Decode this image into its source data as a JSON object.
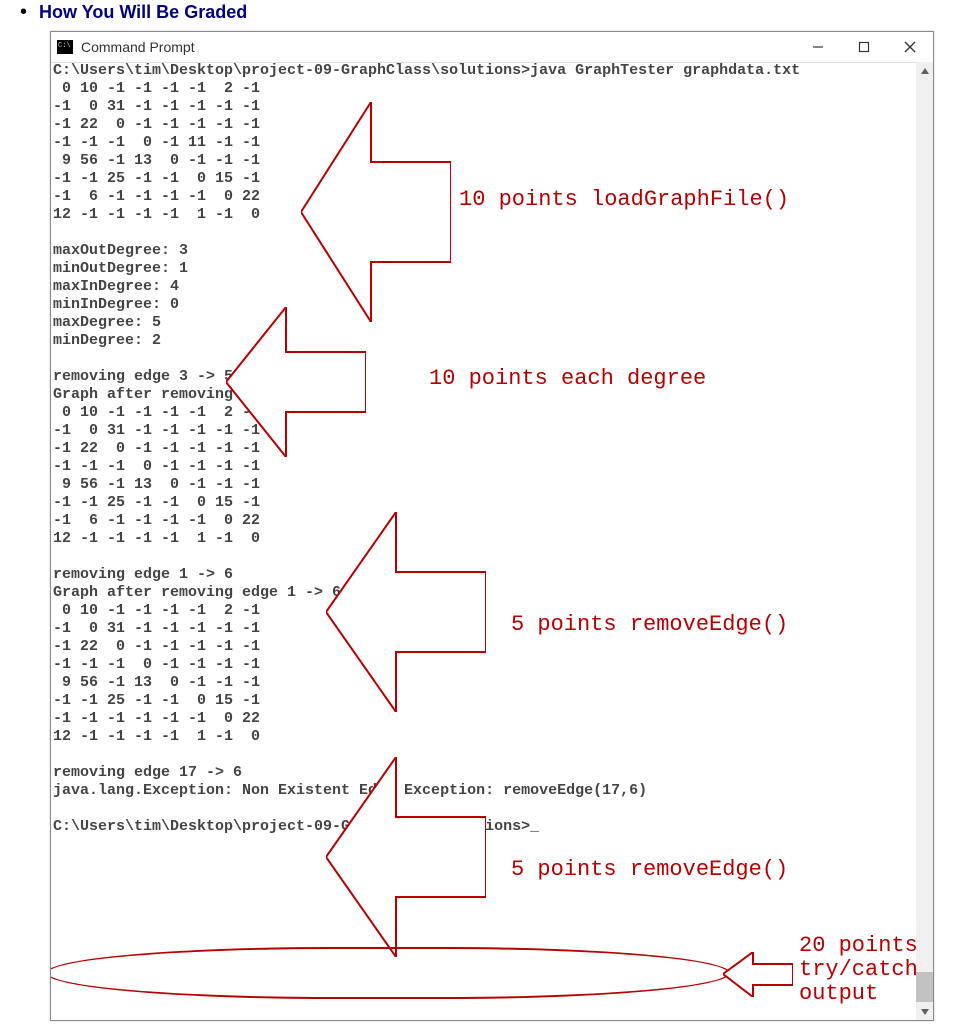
{
  "header": {
    "title": "How You Will Be Graded"
  },
  "window": {
    "title": "Command Prompt"
  },
  "console": {
    "line_cmd1": "C:\\Users\\tim\\Desktop\\project-09-GraphClass\\solutions>java GraphTester graphdata.txt",
    "matrix1": [
      " 0 10 -1 -1 -1 -1  2 -1",
      "-1  0 31 -1 -1 -1 -1 -1",
      "-1 22  0 -1 -1 -1 -1 -1",
      "-1 -1 -1  0 -1 11 -1 -1",
      " 9 56 -1 13  0 -1 -1 -1",
      "-1 -1 25 -1 -1  0 15 -1",
      "-1  6 -1 -1 -1 -1  0 22",
      "12 -1 -1 -1 -1  1 -1  0"
    ],
    "degrees": [
      "maxOutDegree: 3",
      "minOutDegree: 1",
      "maxInDegree: 4",
      "minInDegree: 0",
      "maxDegree: 5",
      "minDegree: 2"
    ],
    "remove1_h1": "removing edge 3 -> 5",
    "remove1_h2": "Graph after removing edge 3 -> 5",
    "matrix2": [
      " 0 10 -1 -1 -1 -1  2 -1",
      "-1  0 31 -1 -1 -1 -1 -1",
      "-1 22  0 -1 -1 -1 -1 -1",
      "-1 -1 -1  0 -1 -1 -1 -1",
      " 9 56 -1 13  0 -1 -1 -1",
      "-1 -1 25 -1 -1  0 15 -1",
      "-1  6 -1 -1 -1 -1  0 22",
      "12 -1 -1 -1 -1  1 -1  0"
    ],
    "remove2_h1": "removing edge 1 -> 6",
    "remove2_h2": "Graph after removing edge 1 -> 6",
    "matrix3": [
      " 0 10 -1 -1 -1 -1  2 -1",
      "-1  0 31 -1 -1 -1 -1 -1",
      "-1 22  0 -1 -1 -1 -1 -1",
      "-1 -1 -1  0 -1 -1 -1 -1",
      " 9 56 -1 13  0 -1 -1 -1",
      "-1 -1 25 -1 -1  0 15 -1",
      "-1 -1 -1 -1 -1 -1  0 22",
      "12 -1 -1 -1 -1  1 -1  0"
    ],
    "remove3_h1": "removing edge 17 -> 6",
    "exception": "java.lang.Exception: Non Existent Edge Exception: removeEdge(17,6)",
    "prompt_end": "C:\\Users\\tim\\Desktop\\project-09-GraphClass\\solutions>_"
  },
  "annotations": {
    "a1": "10 points loadGraphFile()",
    "a2": "10 points each degree",
    "a3": "5 points removeEdge()",
    "a4": "5 points removeEdge()",
    "a5_l1": "20 points",
    "a5_l2": "try/catch",
    "a5_l3": "output"
  }
}
